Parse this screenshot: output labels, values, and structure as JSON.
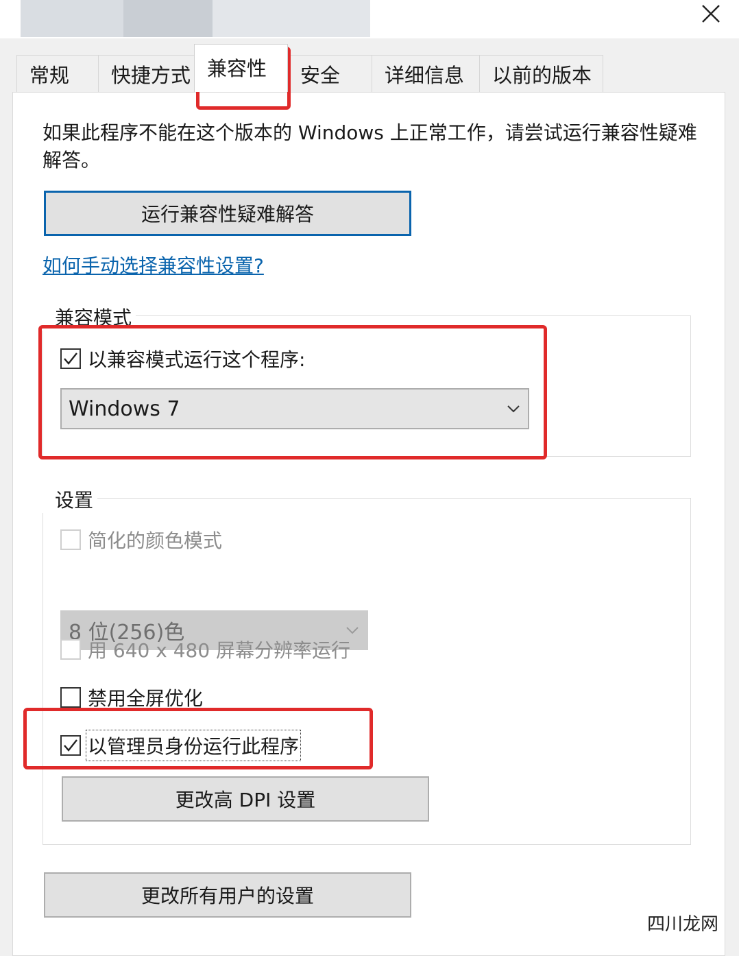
{
  "window": {
    "close_icon": "close-icon"
  },
  "tabs": [
    {
      "label": "常规",
      "active": false
    },
    {
      "label": "快捷方式",
      "active": false
    },
    {
      "label": "兼容性",
      "active": true
    },
    {
      "label": "安全",
      "active": false
    },
    {
      "label": "详细信息",
      "active": false
    },
    {
      "label": "以前的版本",
      "active": false
    }
  ],
  "compat": {
    "intro": "如果此程序不能在这个版本的 Windows 上正常工作，请尝试运行兼容性疑难解答。",
    "troubleshoot_button": "运行兼容性疑难解答",
    "help_link": "如何手动选择兼容性设置?"
  },
  "compat_mode": {
    "legend": "兼容模式",
    "checkbox_label": "以兼容模式运行这个程序:",
    "checked": true,
    "os_selected": "Windows 7"
  },
  "settings": {
    "legend": "设置",
    "reduced_color": {
      "label": "简化的颜色模式",
      "checked": false,
      "enabled": false
    },
    "color_selected": "8 位(256)色",
    "res_640": {
      "label": "用 640 x 480 屏幕分辨率运行",
      "checked": false,
      "enabled": false
    },
    "disable_fullscreen": {
      "label": "禁用全屏优化",
      "checked": false
    },
    "run_as_admin": {
      "label": "以管理员身份运行此程序",
      "checked": true
    },
    "dpi_button": "更改高 DPI 设置"
  },
  "all_users_button": "更改所有用户的设置",
  "watermark": "四川龙网",
  "colors": {
    "highlight": "#e02a2a",
    "link": "#0a64ad"
  }
}
